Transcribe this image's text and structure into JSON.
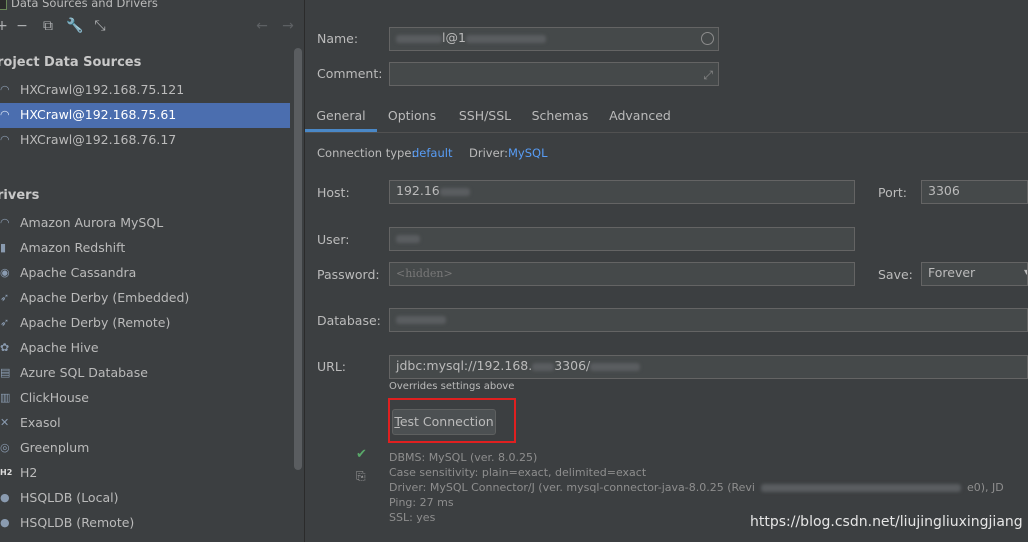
{
  "window": {
    "title": "Data Sources and Drivers"
  },
  "toolbar": {
    "add_icon": "plus-icon",
    "remove_icon": "minus-icon",
    "duplicate_icon": "duplicate-icon",
    "properties_icon": "wrench-icon",
    "import_icon": "import-icon",
    "back_icon": "arrow-left-icon",
    "forward_icon": "arrow-right-icon"
  },
  "sidebar": {
    "project_header": "roject Data Sources",
    "sources": [
      {
        "label": "HXCrawl@192.168.75.121",
        "selected": false
      },
      {
        "label": "HXCrawl@192.168.75.61",
        "selected": true
      },
      {
        "label": "HXCrawl@192.168.76.17",
        "selected": false
      }
    ],
    "drivers_header": "rivers",
    "drivers": [
      {
        "label": "Amazon Aurora MySQL",
        "icon": "aurora-icon"
      },
      {
        "label": "Amazon Redshift",
        "icon": "redshift-icon"
      },
      {
        "label": "Apache Cassandra",
        "icon": "cassandra-icon"
      },
      {
        "label": "Apache Derby (Embedded)",
        "icon": "derby-icon"
      },
      {
        "label": "Apache Derby (Remote)",
        "icon": "derby-icon"
      },
      {
        "label": "Apache Hive",
        "icon": "hive-icon"
      },
      {
        "label": "Azure SQL Database",
        "icon": "azure-icon"
      },
      {
        "label": "ClickHouse",
        "icon": "clickhouse-icon"
      },
      {
        "label": "Exasol",
        "icon": "exasol-icon"
      },
      {
        "label": "Greenplum",
        "icon": "greenplum-icon"
      },
      {
        "label": "H2",
        "icon": "h2-icon"
      },
      {
        "label": "HSQLDB (Local)",
        "icon": "hsqldb-icon"
      },
      {
        "label": "HSQLDB (Remote)",
        "icon": "hsqldb-icon"
      }
    ]
  },
  "form": {
    "name_label": "Name:",
    "name_value_a": "l@1",
    "name_value_b": "",
    "comment_label": "Comment:",
    "tabs": [
      "General",
      "Options",
      "SSH/SSL",
      "Schemas",
      "Advanced"
    ],
    "active_tab": "General",
    "connection_type_label": "Connection type:",
    "connection_type_value": "default",
    "driver_label": "Driver:",
    "driver_value": "MySQL",
    "host_label": "Host:",
    "host_value": "192.16",
    "port_label": "Port:",
    "port_value": "3306",
    "user_label": "User:",
    "password_label": "Password:",
    "password_placeholder": "<hidden>",
    "save_label": "Save:",
    "save_value": "Forever",
    "database_label": "Database:",
    "url_label": "URL:",
    "url_value_a": "jdbc:mysql://192.168.",
    "url_value_b": "3306/",
    "url_hint": "Overrides settings above",
    "test_button": "Test Connection",
    "test_button_mnemonic": "T",
    "test_button_rest": "est Connection"
  },
  "result": {
    "status_icon": "check-icon",
    "copy_icon": "copy-icon",
    "dbms": "DBMS: MySQL (ver. 8.0.25)",
    "case": "Case sensitivity: plain=exact, delimited=exact",
    "driver_a": "Driver: MySQL Connector/J (ver. mysql-connector-java-8.0.25 (Revi",
    "driver_b": "e0), JD",
    "ping": "Ping: 27 ms",
    "ssl": "SSL: yes"
  },
  "watermark": "https://blog.csdn.net/liujingliuxingjiang",
  "colors": {
    "selection": "#4b6eaf",
    "link": "#589df6",
    "highlight": "#e02020",
    "success": "#59a869"
  }
}
